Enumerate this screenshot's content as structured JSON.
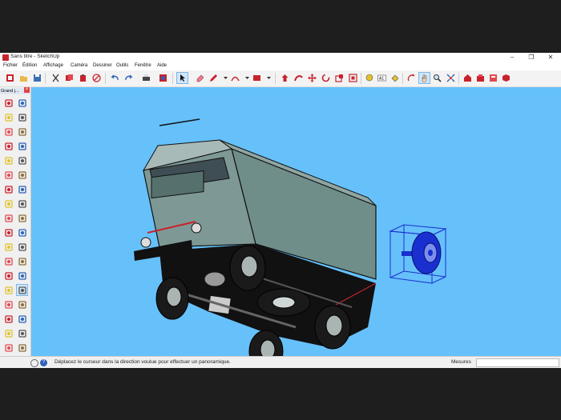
{
  "window": {
    "title": "Sans titre - SketchUp"
  },
  "menu": [
    "Fichier",
    "Édition",
    "Affichage",
    "Caméra",
    "Dessiner",
    "Outils",
    "Fenêtre",
    "Aide"
  ],
  "left_panel": {
    "title": "Grand j..."
  },
  "status": {
    "message": "Déplacez le curseur dans la direction voulue pour effectuer un panoramique.",
    "measure_label": "Mesures",
    "measure_value": ""
  },
  "toolbar_icons": [
    "new-file-icon",
    "open-file-icon",
    "save-icon",
    "cut-icon",
    "copy-icon",
    "paste-icon",
    "erase-icon",
    "undo-icon",
    "redo-icon",
    "print-icon",
    "model-info-icon",
    "select-icon",
    "eraser-icon",
    "pencil-icon",
    "line-icon",
    "arc-icon",
    "shape-icon",
    "push-pull-icon",
    "follow-me-icon",
    "move-icon",
    "rotate-icon",
    "scale-icon",
    "offset-icon",
    "tape-measure-icon",
    "text-icon",
    "paint-icon",
    "orbit-icon",
    "pan-icon",
    "zoom-icon",
    "zoom-extents-icon",
    "warehouse-icon",
    "extensions-icon",
    "layout-icon",
    "sketchup-extension-icon"
  ],
  "colors": {
    "viewport_bg": "#66c1fb",
    "accent": "#c8232c",
    "selection": "#1a2fcf"
  }
}
